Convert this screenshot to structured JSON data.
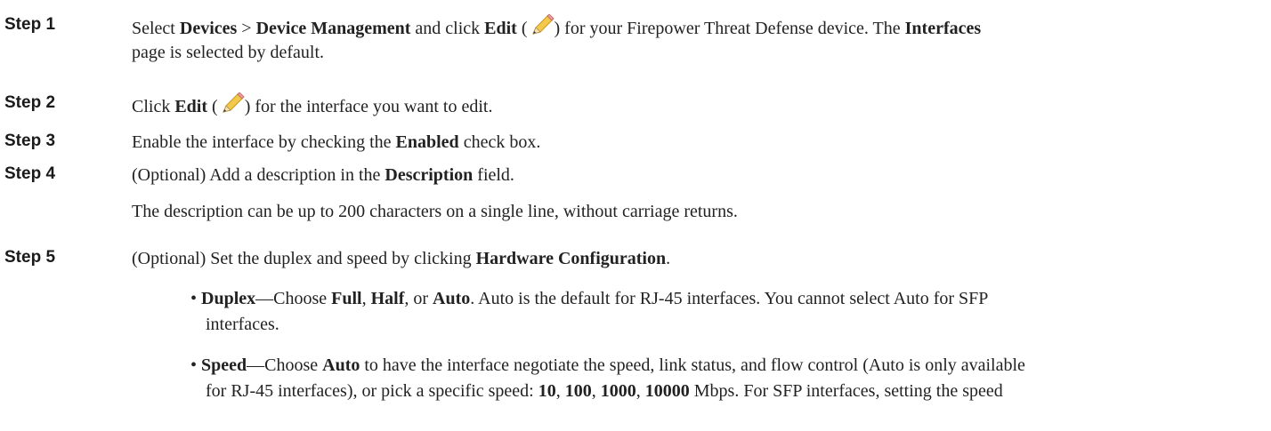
{
  "steps": [
    {
      "label": "Step 1",
      "lines": [
        [
          "Select ",
          "Devices",
          " > ",
          "Device Management",
          " and click ",
          "Edit",
          " (",
          ") for your Firepower Threat Defense device. The ",
          "Interfaces"
        ],
        [
          "page is selected by default."
        ]
      ]
    },
    {
      "label": "Step 2",
      "lines": [
        [
          "Click ",
          "Edit",
          " (",
          ") for the interface you want to edit."
        ]
      ]
    },
    {
      "label": "Step 3",
      "lines": [
        [
          "Enable the interface by checking the ",
          "Enabled",
          " check box."
        ]
      ]
    },
    {
      "label": "Step 4",
      "lines": [
        [
          "(Optional) Add a description in the ",
          "Description",
          " field."
        ]
      ],
      "note": "The description can be up to 200 characters on a single line, without carriage returns."
    },
    {
      "label": "Step 5",
      "lines": [
        [
          "(Optional) Set the duplex and speed by clicking ",
          "Hardware Configuration",
          "."
        ]
      ],
      "bullets": [
        {
          "lines": [
            [
              "• ",
              "Duplex",
              "—Choose ",
              "Full",
              ", ",
              "Half",
              ", or ",
              "Auto",
              ". Auto is the default for RJ-45 interfaces. You cannot select Auto for SFP"
            ],
            [
              "interfaces."
            ]
          ]
        },
        {
          "lines": [
            [
              "• ",
              "Speed",
              "—Choose ",
              "Auto",
              " to have the interface negotiate the speed, link status, and flow control (Auto is only available"
            ],
            [
              "for RJ-45 interfaces), or pick a specific speed: ",
              "10",
              ", ",
              "100",
              ", ",
              "1000",
              ", ",
              "10000",
              " Mbps. For SFP interfaces, setting the speed"
            ]
          ]
        }
      ]
    }
  ],
  "icons": {
    "edit": "pencil-icon"
  }
}
